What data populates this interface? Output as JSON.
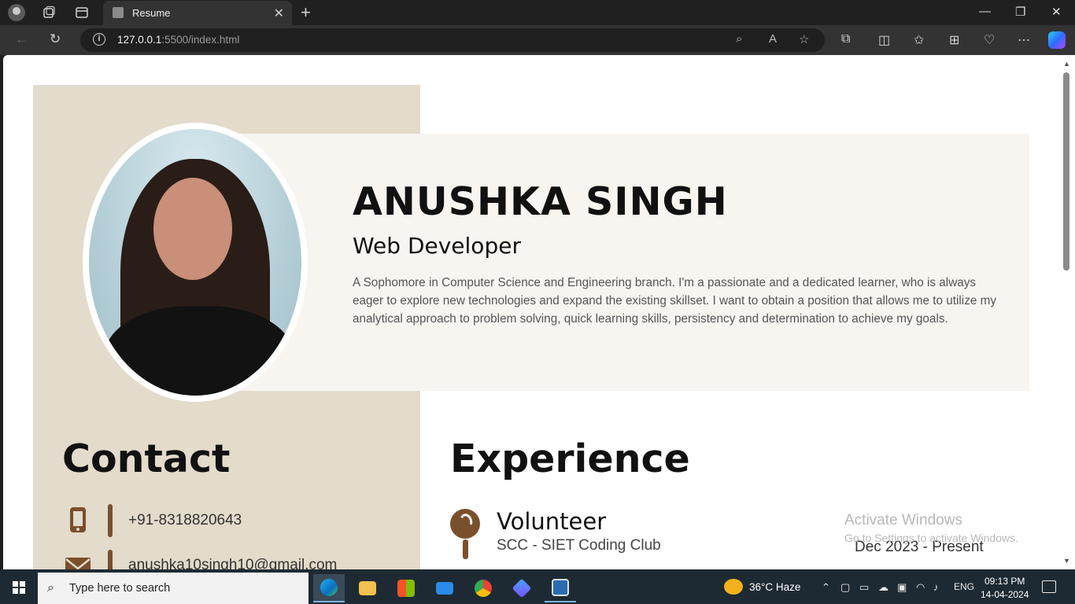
{
  "browser": {
    "tab_title": "Resume",
    "url_host": "127.0.0.1",
    "url_path": ":5500/index.html"
  },
  "profile": {
    "name": "ANUSHKA SINGH",
    "role": "Web Developer",
    "summary": "A Sophomore in Computer Science and Engineering branch. I'm a passionate and a dedicated learner, who is always eager to explore new technologies and expand the existing skillset. I want to obtain a position that allows me to utilize my analytical approach to problem solving, quick learning skills, persistency and determination to achieve my goals."
  },
  "contact": {
    "heading": "Contact",
    "phone": "+91-8318820643",
    "email": "anushka10singh10@gmail.com"
  },
  "experience": {
    "heading": "Experience",
    "items": [
      {
        "title": "Volunteer",
        "org": "SCC - SIET Coding Club",
        "date": "Dec 2023 - Present"
      }
    ]
  },
  "watermark": {
    "line1": "Activate Windows",
    "line2": "Go to Settings to activate Windows."
  },
  "taskbar": {
    "search_placeholder": "Type here to search",
    "weather": "36°C  Haze",
    "language": "ENG",
    "time": "09:13 PM",
    "date": "14-04-2024"
  },
  "colors": {
    "accent_brown": "#7a4f2c",
    "sidebar_beige": "#e3dbcb",
    "hero_cream": "#f8f5f0"
  }
}
